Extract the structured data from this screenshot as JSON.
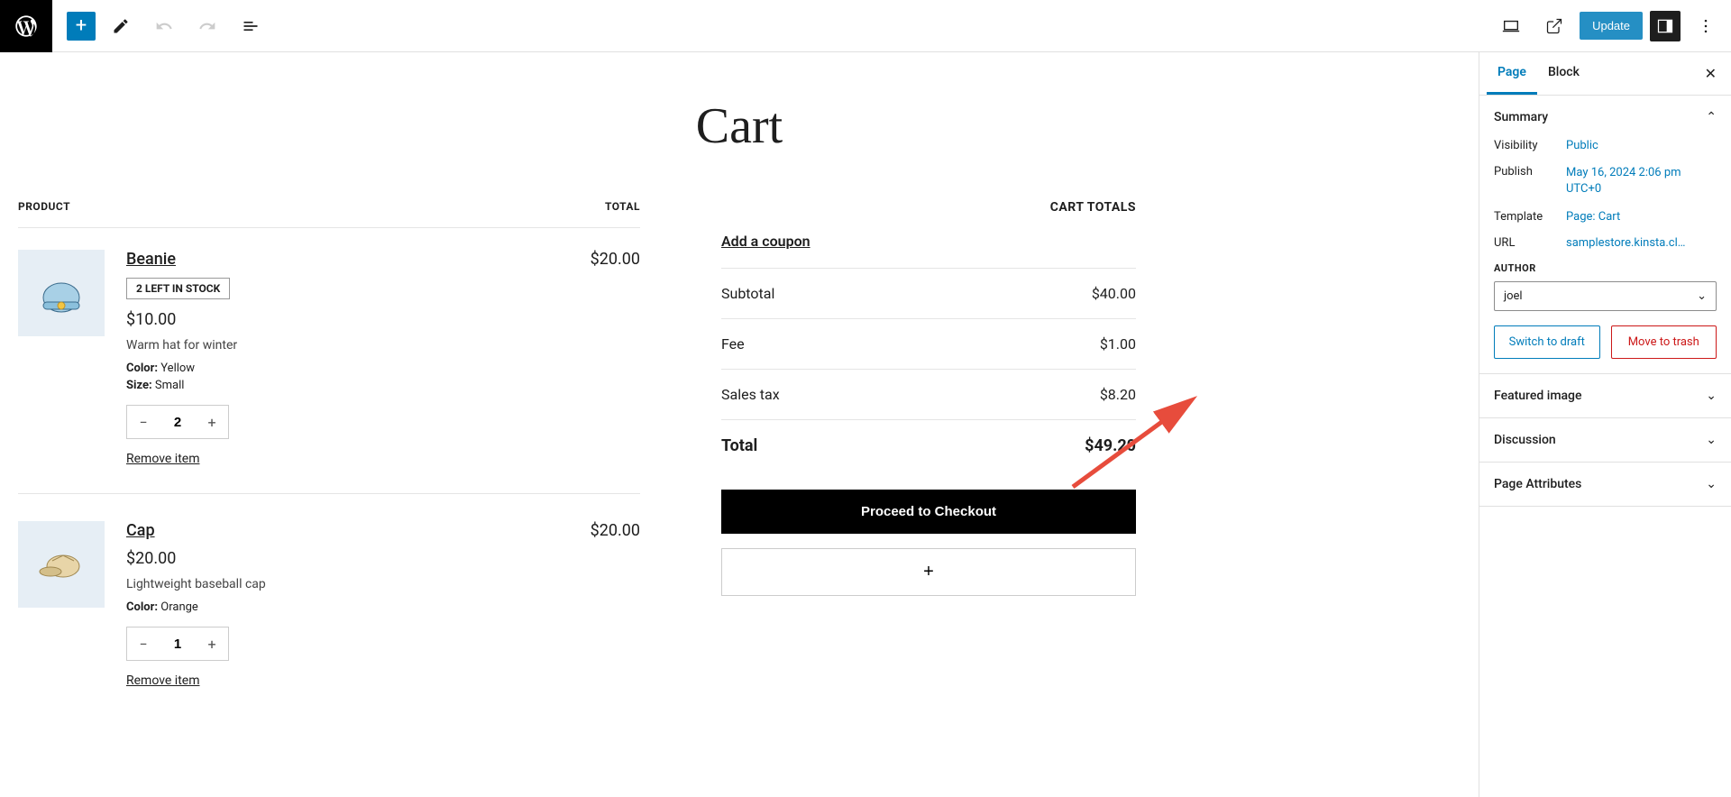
{
  "topbar": {
    "update": "Update"
  },
  "page": {
    "title": "Cart",
    "header_product": "PRODUCT",
    "header_total": "TOTAL",
    "items": [
      {
        "name": "Beanie",
        "stock_badge": "2 LEFT IN STOCK",
        "price": "$10.00",
        "desc": "Warm hat for winter",
        "meta": [
          {
            "label": "Color:",
            "value": "Yellow"
          },
          {
            "label": "Size:",
            "value": "Small"
          }
        ],
        "qty": "2",
        "remove": "Remove item",
        "line_total": "$20.00",
        "icon": "beanie"
      },
      {
        "name": "Cap",
        "stock_badge": "",
        "price": "$20.00",
        "desc": "Lightweight baseball cap",
        "meta": [
          {
            "label": "Color:",
            "value": "Orange"
          }
        ],
        "qty": "1",
        "remove": "Remove item",
        "line_total": "$20.00",
        "icon": "cap"
      }
    ],
    "totals_title": "CART TOTALS",
    "coupon": "Add a coupon",
    "totals": [
      {
        "label": "Subtotal",
        "value": "$40.00"
      },
      {
        "label": "Fee",
        "value": "$1.00"
      },
      {
        "label": "Sales tax",
        "value": "$8.20"
      }
    ],
    "grand_label": "Total",
    "grand_value": "$49.20",
    "checkout": "Proceed to Checkout"
  },
  "sidebar": {
    "tabs": {
      "page": "Page",
      "block": "Block"
    },
    "sections": {
      "summary": "Summary",
      "featured": "Featured image",
      "discussion": "Discussion",
      "attributes": "Page Attributes"
    },
    "meta": {
      "visibility_label": "Visibility",
      "visibility_value": "Public",
      "publish_label": "Publish",
      "publish_value": "May 16, 2024 2:06 pm UTC+0",
      "template_label": "Template",
      "template_value": "Page: Cart",
      "url_label": "URL",
      "url_value": "samplestore.kinsta.cl…",
      "author_label": "AUTHOR",
      "author_value": "joel"
    },
    "actions": {
      "draft": "Switch to draft",
      "trash": "Move to trash"
    }
  }
}
